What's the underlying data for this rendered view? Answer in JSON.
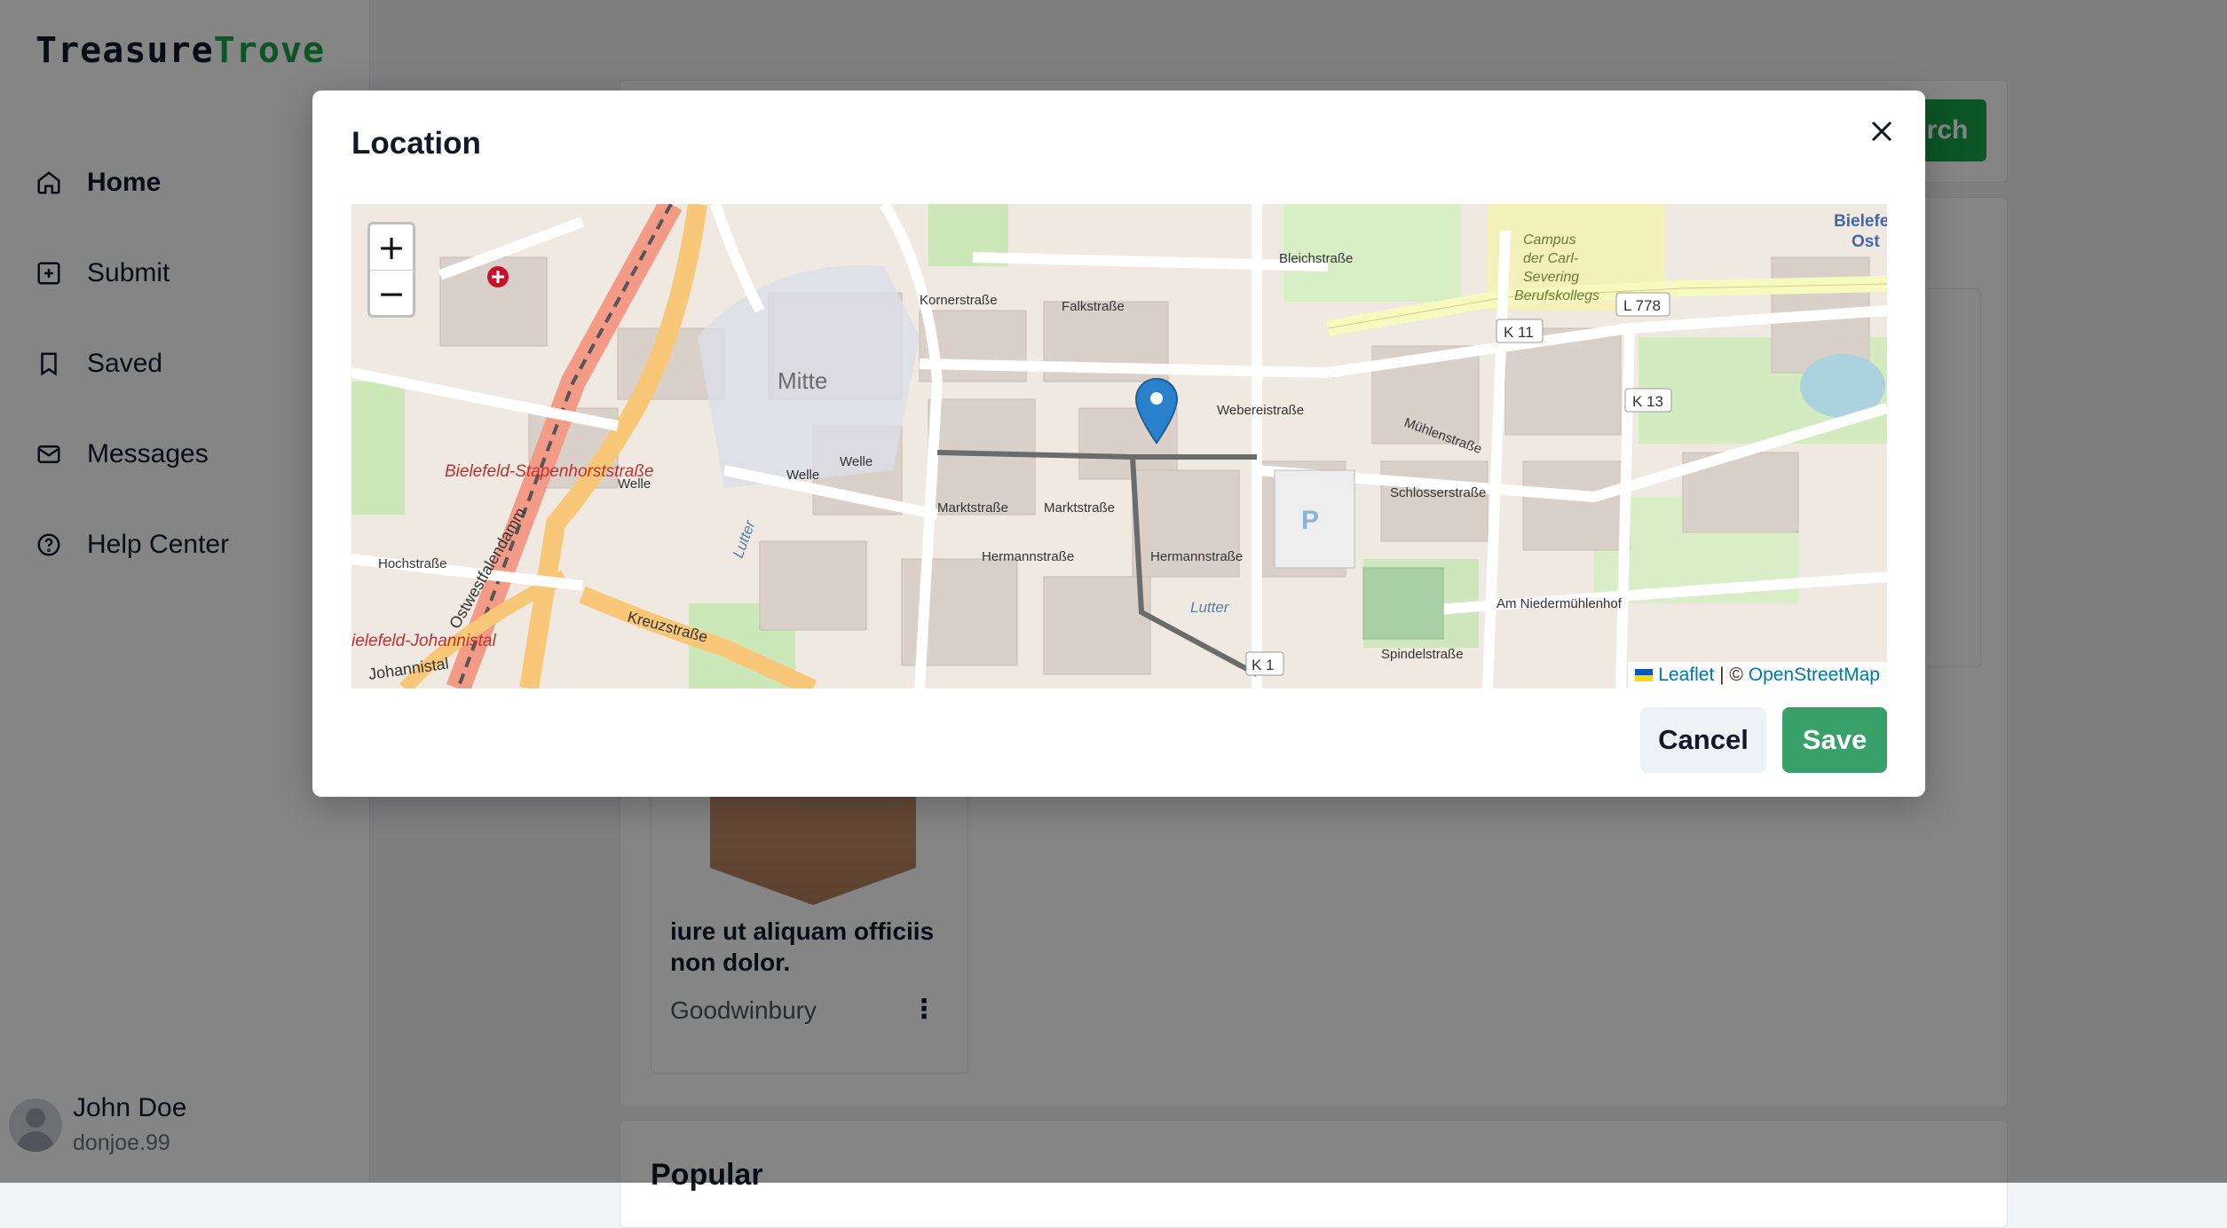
{
  "app": {
    "brand_part1": "Treasure",
    "brand_part2": "Trove"
  },
  "sidebar": {
    "items": [
      {
        "label": "Home",
        "icon": "home-icon",
        "active": true
      },
      {
        "label": "Submit",
        "icon": "plus-square-icon",
        "active": false
      },
      {
        "label": "Saved",
        "icon": "bookmark-icon",
        "active": false
      },
      {
        "label": "Messages",
        "icon": "mail-icon",
        "active": false
      },
      {
        "label": "Help Center",
        "icon": "help-circle-icon",
        "active": false
      }
    ]
  },
  "user": {
    "name": "John Doe",
    "handle": "donjoe.99"
  },
  "background": {
    "search_button_partial": "rch",
    "product": {
      "title": "iure ut aliquam officiis non dolor.",
      "location": "Goodwinbury",
      "more": "⋮"
    },
    "section_heading": "Popular"
  },
  "modal": {
    "title": "Location",
    "cancel_label": "Cancel",
    "save_label": "Save",
    "zoom_in": "+",
    "zoom_out": "−",
    "attribution_leaflet": "Leaflet",
    "attribution_sep": " | © ",
    "attribution_osm": "OpenStreetMap"
  },
  "map_labels": {
    "mitte": "Mitte",
    "bielefeld_stapenhorst": "Bielefeld-Stapenhorststraße",
    "bielefeld_johannistal": "ielefeld-Johannistal",
    "johannistal": "Johannistal",
    "ostwestfalendamm": "Ostwestfalendamm",
    "kreuzstrasse": "Kreuzstraße",
    "hochstrasse": "Hochstraße",
    "markstrasse1": "Marktstraße",
    "markstrasse2": "Marktstraße",
    "hermannstrasse1": "Hermannstraße",
    "hermannstrasse2": "Hermannstraße",
    "webereistrasse": "Webereistraße",
    "schlossstrasse": "Schlosserstraße",
    "muehlenstrasse": "Mühlenstraße",
    "bleichstrasse": "Bleichstraße",
    "campus1": "Campus",
    "campus2": "der Carl-",
    "campus3": "Severing",
    "campus4": "Berufskollegs",
    "am_niedermuehlenhof": "Am Niedermühlenhof",
    "spindelstrasse": "Spindelstraße",
    "lutter1": "Lutter",
    "lutter2": "Lutter",
    "falkstrasse": "Falkstraße",
    "kornerstrasse": "Kornerstraße",
    "l778": "L 778",
    "k11": "K 11",
    "k13": "K 13",
    "k1": "K 1",
    "bielefeld_ost": "Bielefe",
    "ost": "Ost",
    "welle1": "Welle",
    "welle2": "Welle",
    "welle3": "Welle",
    "p": "P"
  }
}
